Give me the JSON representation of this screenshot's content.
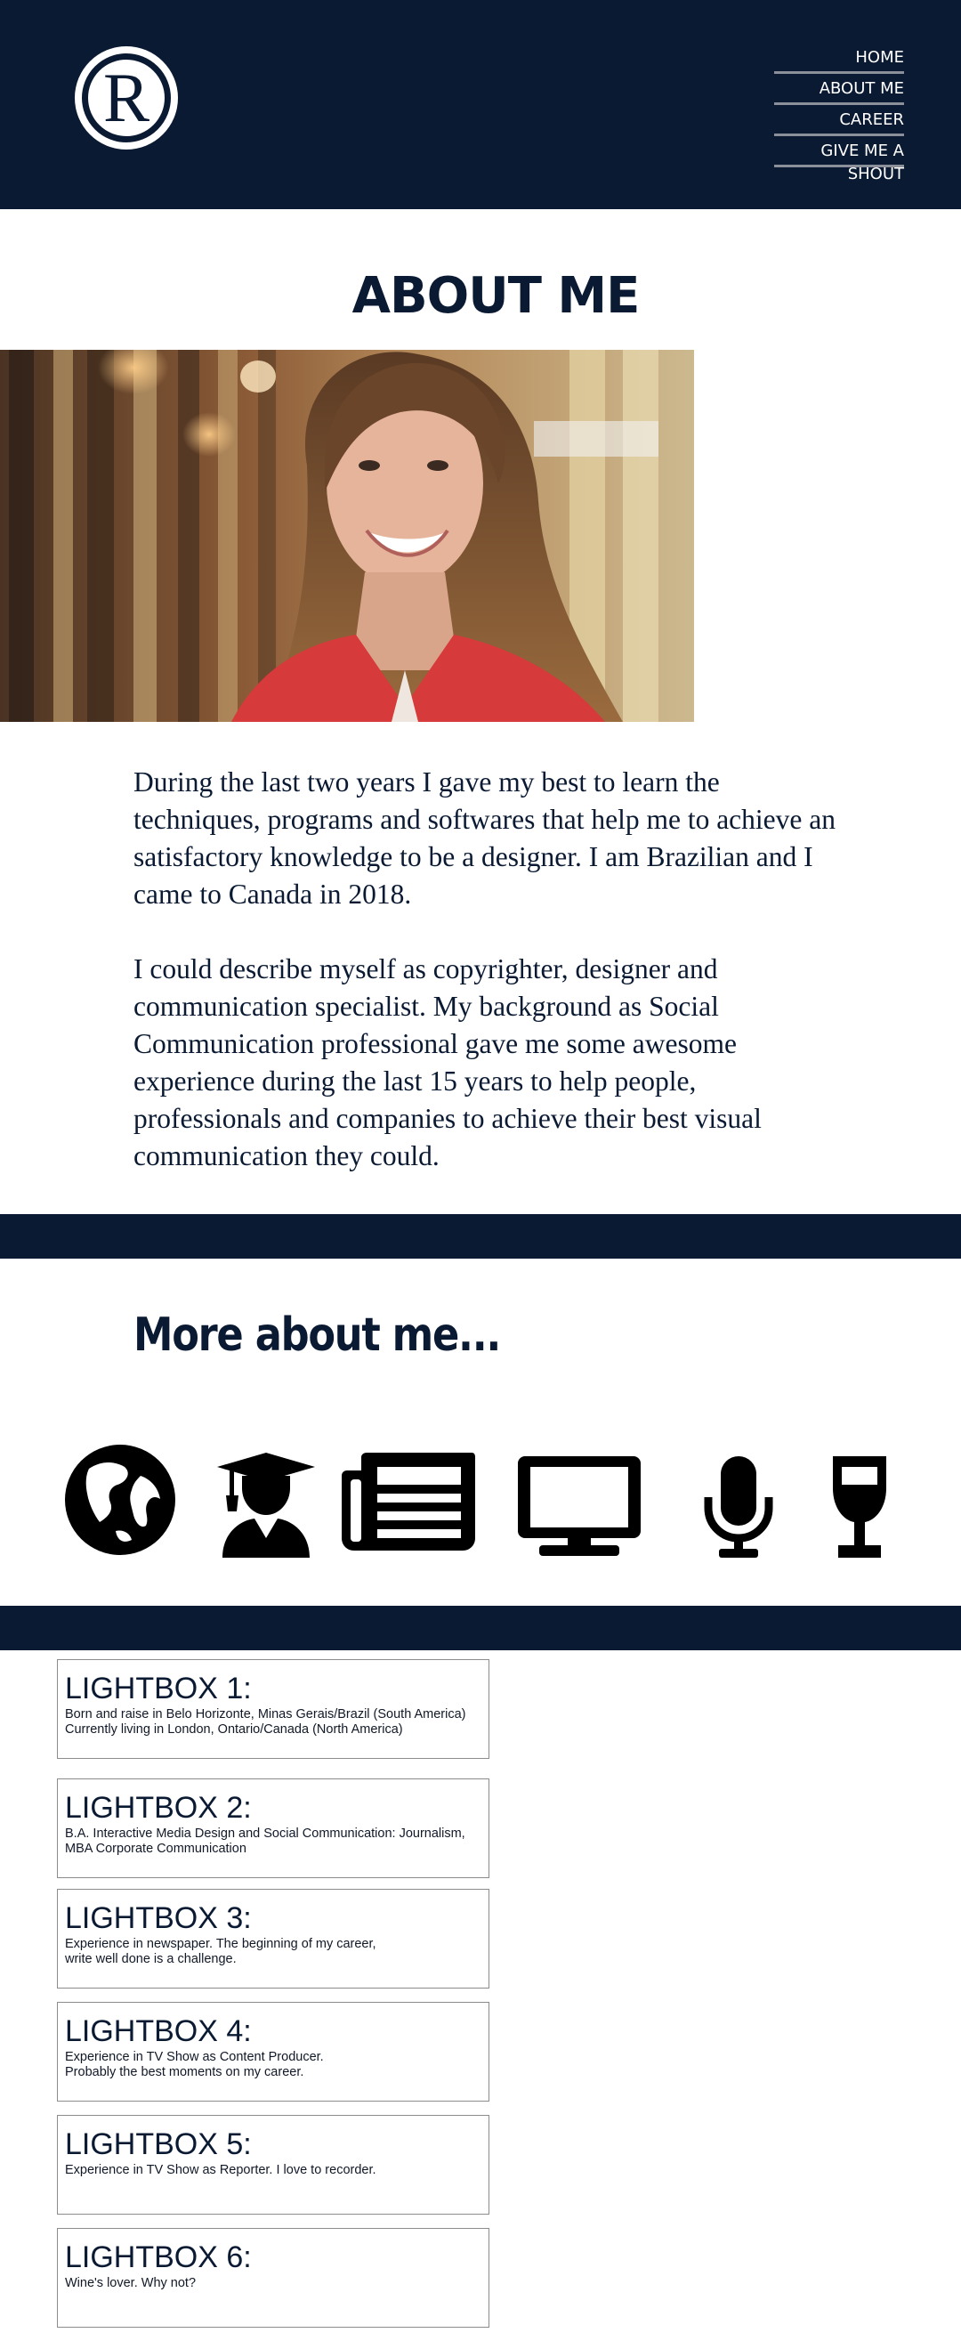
{
  "header": {
    "logo_letter": "R",
    "nav": [
      {
        "label": "HOME"
      },
      {
        "label": "ABOUT ME"
      },
      {
        "label": "CAREER"
      },
      {
        "label": "GIVE ME A SHOUT"
      }
    ]
  },
  "main": {
    "title": "ABOUT ME",
    "paragraphs": [
      "During the last two years I gave my best to learn the techniques, programs and softwares that help me to achieve an satisfactory knowledge to be a designer. I am Brazilian and I came to Canada in 2018.",
      "I could describe myself as copyrighter, designer and communication specialist. My background as Social Communication professional gave me some awesome experience during the last 15 years to help people, professionals and companies to achieve their best visual communication they could."
    ],
    "more_title": "More about me...",
    "icons": [
      "globe-icon",
      "graduate-icon",
      "newspaper-icon",
      "tv-monitor-icon",
      "microphone-icon",
      "wine-glass-icon"
    ]
  },
  "lightboxes": [
    {
      "title": "LIGHTBOX 1:",
      "text": "Born and raise in Belo Horizonte, Minas Gerais/Brazil (South America)\nCurrently living in London, Ontario/Canada (North America)"
    },
    {
      "title": "LIGHTBOX 2:",
      "text": "B.A. Interactive Media Design and Social Communication: Journalism,\nMBA Corporate Communication"
    },
    {
      "title": "LIGHTBOX 3:",
      "text": "Experience in newspaper. The beginning of my career,\nwrite well done is a challenge."
    },
    {
      "title": "LIGHTBOX 4:",
      "text": "Experience in TV Show as Content Producer.\nProbably the best moments on my career."
    },
    {
      "title": "LIGHTBOX 5:",
      "text": "Experience in TV Show as Reporter. I love to recorder."
    },
    {
      "title": "LIGHTBOX 6:",
      "text": "Wine's lover. Why not?"
    }
  ],
  "colors": {
    "navy": "#0b1a33",
    "white": "#ffffff",
    "border": "#8c8c8c"
  }
}
